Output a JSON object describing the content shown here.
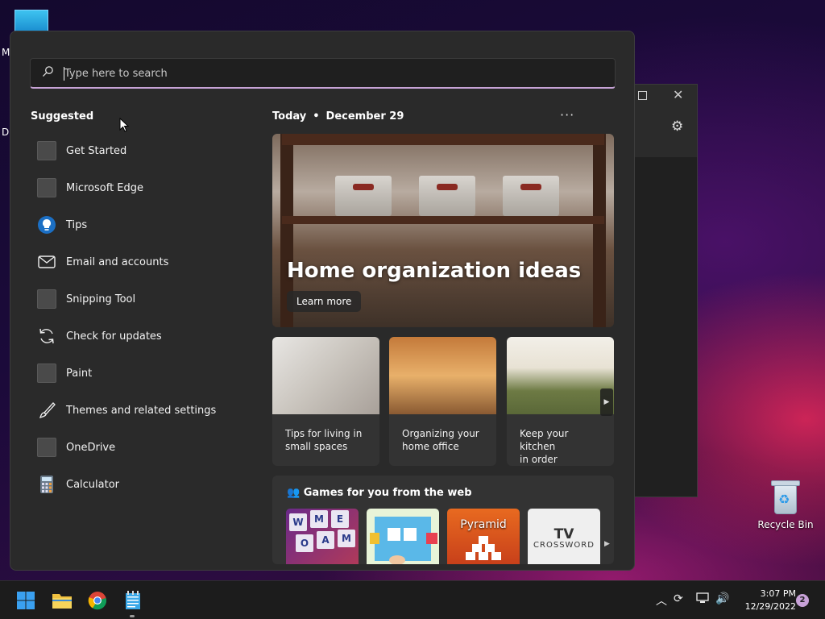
{
  "desktop": {
    "fragment_top": "M",
    "fragment_mid": "Da",
    "recycle_bin_label": "Recycle Bin"
  },
  "start_menu": {
    "search": {
      "placeholder": "Type here to search",
      "value": ""
    },
    "suggested_title": "Suggested",
    "suggested": [
      {
        "label": "Get Started",
        "icon": "app-placeholder-icon"
      },
      {
        "label": "Microsoft Edge",
        "icon": "app-placeholder-icon"
      },
      {
        "label": "Tips",
        "icon": "lightbulb-icon"
      },
      {
        "label": "Email and accounts",
        "icon": "mail-icon"
      },
      {
        "label": "Snipping Tool",
        "icon": "app-placeholder-icon"
      },
      {
        "label": "Check for updates",
        "icon": "refresh-icon"
      },
      {
        "label": "Paint",
        "icon": "app-placeholder-icon"
      },
      {
        "label": "Themes and related settings",
        "icon": "brush-icon"
      },
      {
        "label": "OneDrive",
        "icon": "app-placeholder-icon"
      },
      {
        "label": "Calculator",
        "icon": "calculator-icon"
      }
    ],
    "today": {
      "label": "Today",
      "separator": "•",
      "date": "December 29",
      "more": "···"
    },
    "hero": {
      "title": "Home organization ideas",
      "button": "Learn more"
    },
    "cards": [
      {
        "line1": "Tips for living in",
        "line2": "small spaces"
      },
      {
        "line1": "Organizing your",
        "line2": "home office"
      },
      {
        "line1": "Keep your kitchen",
        "line2": "in order"
      }
    ],
    "games": {
      "title": "Games for you from the web",
      "tiles": [
        {
          "name": "word-game"
        },
        {
          "name": "block-game"
        },
        {
          "name": "pyramid",
          "label": "Pyramid"
        },
        {
          "name": "tv-crossword",
          "label1": "TV",
          "label2": "CROSSWORD"
        }
      ]
    }
  },
  "taskbar": {
    "clock_time": "3:07 PM",
    "clock_date": "12/29/2022",
    "notification_count": "2"
  },
  "colors": {
    "accent": "#c7a3d6",
    "panel": "#2a2a2a",
    "taskbar": "#1c1c1c"
  }
}
